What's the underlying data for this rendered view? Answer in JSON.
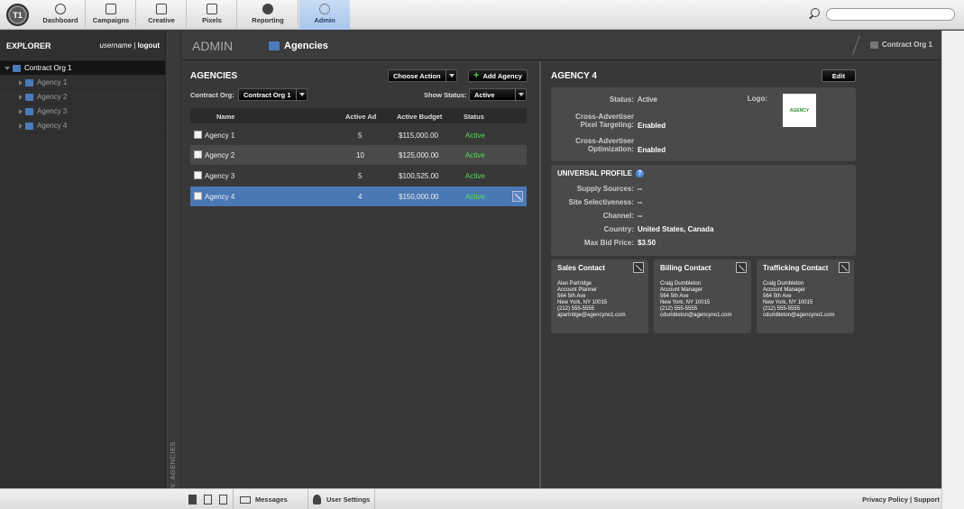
{
  "nav": {
    "logo": "T1",
    "tabs": [
      {
        "label": "Dashboard",
        "icon": "dashboard-icon"
      },
      {
        "label": "Campaigns",
        "icon": "campaigns-icon"
      },
      {
        "label": "Creative",
        "icon": "creative-icon"
      },
      {
        "label": "Pixels",
        "icon": "pixels-icon"
      },
      {
        "label": "Reporting",
        "icon": "reporting-icon"
      },
      {
        "label": "Admin",
        "icon": "gear-icon",
        "active": true
      }
    ],
    "search_placeholder": ""
  },
  "explorer": {
    "title": "EXPLORER",
    "username": "username",
    "logout": "logout",
    "root": "Contract Org 1",
    "items": [
      "Agency 1",
      "Agency 2",
      "Agency 3",
      "Agency 4"
    ]
  },
  "side_label": "ADMIN: AGENCIES",
  "header": {
    "section": "ADMIN",
    "page": "Agencies",
    "org": "Contract Org 1"
  },
  "agencies": {
    "title": "AGENCIES",
    "choose_action": "Choose Action",
    "add_agency": "Add Agency",
    "contract_org_label": "Contract Org:",
    "contract_org_value": "Contract Org 1",
    "show_status_label": "Show Status:",
    "show_status_value": "Active",
    "columns": [
      "Name",
      "Active Ad",
      "Active Budget",
      "Status"
    ],
    "rows": [
      {
        "name": "Agency 1",
        "active_ad": "5",
        "budget": "$115,000.00",
        "status": "Active"
      },
      {
        "name": "Agency 2",
        "active_ad": "10",
        "budget": "$125,000.00",
        "status": "Active"
      },
      {
        "name": "Agency 3",
        "active_ad": "5",
        "budget": "$100,525.00",
        "status": "Active"
      },
      {
        "name": "Agency 4",
        "active_ad": "4",
        "budget": "$150,000.00",
        "status": "Active"
      }
    ]
  },
  "detail": {
    "title": "AGENCY 4",
    "edit": "Edit",
    "status_label": "Status:",
    "status_value": "Active",
    "logo_label": "Logo:",
    "logo_text": "AGENCY",
    "cross_pixel_label_1": "Cross-Advertiser",
    "cross_pixel_label_2": "Pixel Targeting:",
    "cross_pixel_value": "Enabled",
    "cross_opt_label_1": "Cross-Advertiser",
    "cross_opt_label_2": "Optimization:",
    "cross_opt_value": "Enabled",
    "universal_profile": {
      "title": "UNIVERSAL PROFILE",
      "fields": [
        {
          "label": "Supply Sources:",
          "value": "--"
        },
        {
          "label": "Site Selectiveness:",
          "value": "--"
        },
        {
          "label": "Channel:",
          "value": "--"
        },
        {
          "label": "Country:",
          "value": "United States, Canada"
        },
        {
          "label": "Max Bid Price:",
          "value": "$3.50"
        }
      ]
    },
    "contacts": [
      {
        "title": "Sales Contact",
        "lines": [
          "Alan Partridge",
          "Account Planner",
          "564 5th Ave",
          "New York, NY 10015",
          "(212) 555-5555",
          "apartridge@agencyno1.com"
        ]
      },
      {
        "title": "Billing Contact",
        "lines": [
          "Craig Dumbleton",
          "Account Manager",
          "564 5th Ave",
          "New York, NY 10015",
          "(212) 555-5555",
          "cdumbleton@agencyno1.com"
        ]
      },
      {
        "title": "Trafficking Contact",
        "lines": [
          "Craig Dumbleton",
          "Account Manager",
          "564 5th Ave",
          "New York, NY 10015",
          "(212) 555-5555",
          "cdumbleton@agencyno1.com"
        ]
      }
    ]
  },
  "bottom": {
    "messages": "Messages",
    "user_settings": "User Settings",
    "privacy": "Privacy Policy",
    "divider": "|",
    "support": "Support"
  }
}
